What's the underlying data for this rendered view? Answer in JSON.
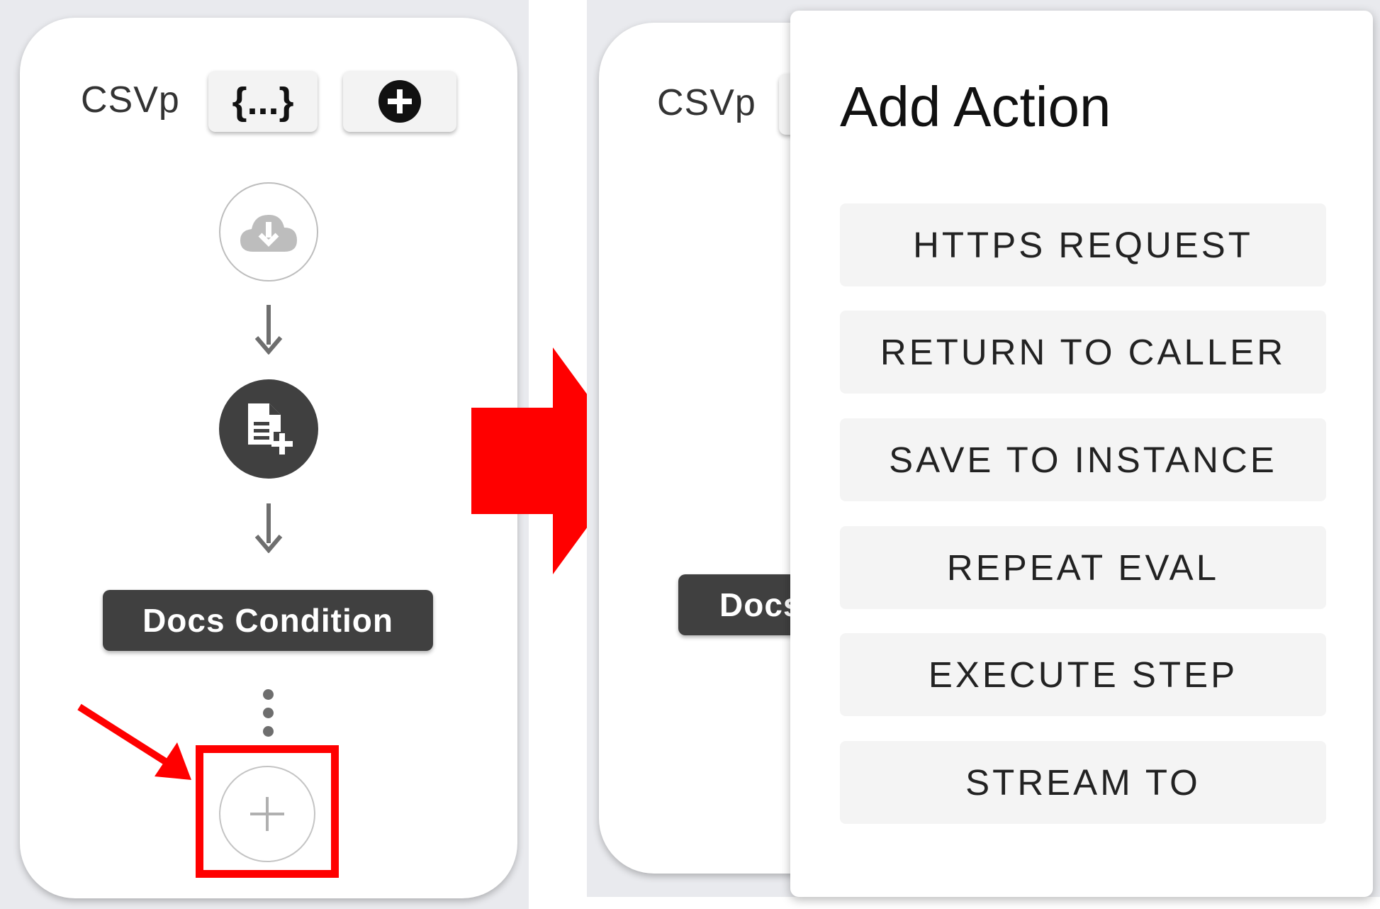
{
  "left_panel": {
    "title": "CSVp",
    "variables_button_label": "{...}",
    "nodes": {
      "step_label": "Docs Condition"
    }
  },
  "right_panel": {
    "title": "CSVp",
    "partial_step_label": "Docs"
  },
  "add_action_menu": {
    "title": "Add Action",
    "items": [
      {
        "label": "HTTPS REQUEST"
      },
      {
        "label": "RETURN TO CALLER"
      },
      {
        "label": "SAVE TO INSTANCE"
      },
      {
        "label": "REPEAT EVAL"
      },
      {
        "label": "EXECUTE STEP"
      },
      {
        "label": "STREAM TO"
      }
    ]
  },
  "colors": {
    "annotation_red": "#ff0000",
    "node_dark": "#404040",
    "panel_background": "#e9eaee"
  },
  "icons": [
    "braces-icon",
    "add-circle-icon",
    "cloud-download-icon",
    "arrow-down-icon",
    "file-add-icon",
    "more-vertical-icon",
    "plus-icon",
    "arrow-right-icon",
    "pointer-arrow-icon"
  ]
}
